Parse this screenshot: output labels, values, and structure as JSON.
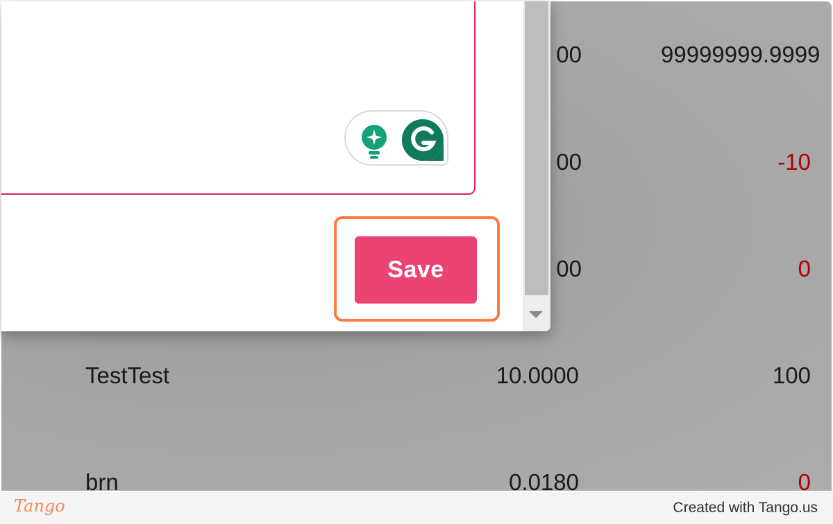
{
  "table": {
    "rows": [
      {
        "name": "",
        "value": "00",
        "qty": "99999999.9999",
        "qty_negative": false
      },
      {
        "name": "",
        "value": "00",
        "qty": "-10",
        "qty_negative": true
      },
      {
        "name": "",
        "value": "00",
        "qty": "0",
        "qty_negative": true
      },
      {
        "name": "TestTest",
        "value": "10.0000",
        "qty": "100",
        "qty_negative": false
      },
      {
        "name": "brn",
        "value": "0.0180",
        "qty": "0",
        "qty_negative": true
      }
    ]
  },
  "dialog": {
    "save_label": "Save",
    "grammarly_icons": [
      "lightbulb-icon",
      "grammarly-g-icon"
    ]
  },
  "footer": {
    "logo_text": "Tango",
    "credit": "Created with Tango.us"
  },
  "colors": {
    "save_button": "#eb4473",
    "textarea_border": "#dc1e50",
    "highlight": "#ff7a40",
    "grammarly": "#15a07a",
    "negative_value": "#b00000"
  }
}
